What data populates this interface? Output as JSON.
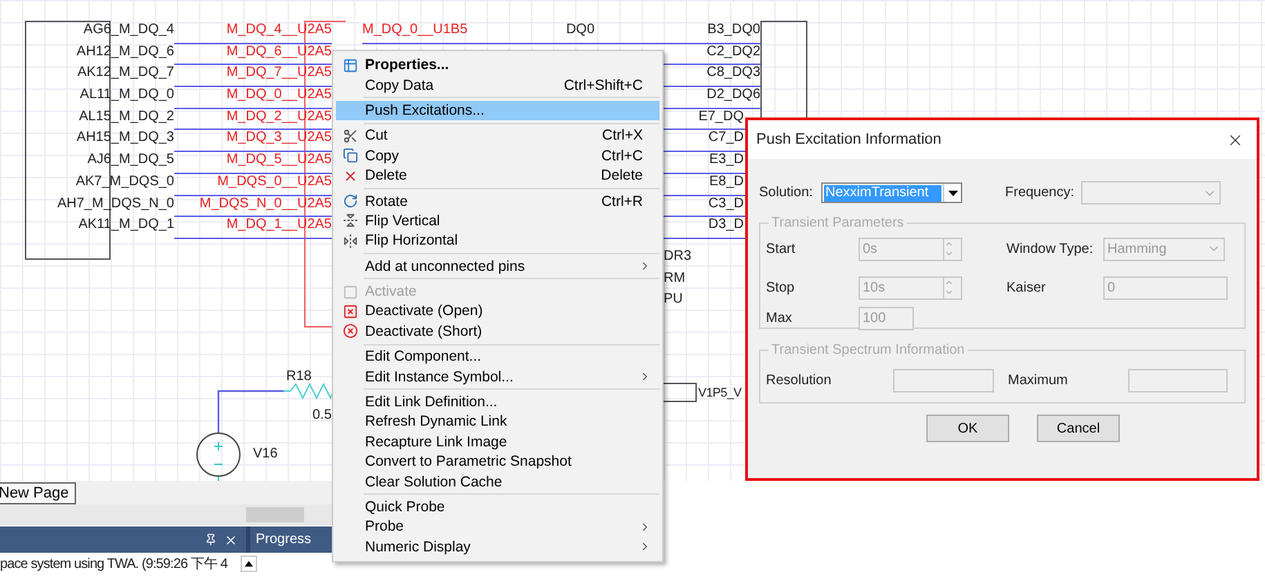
{
  "schematic": {
    "left_pins": [
      "AG6_M_DQ_4",
      "AH12_M_DQ_6",
      "AK12_M_DQ_7",
      "AL11_M_DQ_0",
      "AL15_M_DQ_2",
      "AH15_M_DQ_3",
      "AJ6_M_DQ_5",
      "AK7_M_DQS_0",
      "AH7_M_DQS_N_0",
      "AK11_M_DQ_1"
    ],
    "net_labels": [
      "M_DQ_4__U2A5",
      "M_DQ_6__U2A5",
      "M_DQ_7__U2A5",
      "M_DQ_0__U2A5",
      "M_DQ_2__U2A5",
      "M_DQ_3__U2A5",
      "M_DQ_5__U2A5",
      "M_DQS_0__U2A5",
      "M_DQS_N_0__U2A5",
      "M_DQ_1__U2A5"
    ],
    "far_net_label": "M_DQ_0__U1B5",
    "net_name": "DQ0",
    "right_pins": [
      "B3_DQ0",
      "C2_DQ2",
      "C8_DQ3",
      "D2_DQ6",
      "E7_DQ",
      "C7_D",
      "E3_D",
      "E8_D",
      "C3_D",
      "D3_D"
    ],
    "partial_labels": [
      "DR3",
      "RM",
      "PU"
    ],
    "resistor": {
      "name": "R18",
      "value": "0.5"
    },
    "source": {
      "name": "V16"
    },
    "port_label": "V1P5_V"
  },
  "page_tabs": [
    {
      "label": "New Page"
    }
  ],
  "output_panel": {
    "progress_title": "Progress",
    "message": "pace system using TWA. (9:59:26 下午 4"
  },
  "context_menu": [
    {
      "kind": "item",
      "label": "Properties...",
      "default": true,
      "submenu": false,
      "disabled": false,
      "selected": false
    },
    {
      "kind": "item",
      "label": "Copy Data",
      "default": false,
      "shortcut": "Ctrl+Shift+C",
      "submenu": false,
      "disabled": false,
      "selected": false
    },
    {
      "kind": "separator"
    },
    {
      "kind": "item",
      "label": "Push Excitations...",
      "default": false,
      "submenu": false,
      "disabled": false,
      "selected": true
    },
    {
      "kind": "separator"
    },
    {
      "kind": "item",
      "label": "Cut",
      "default": false,
      "shortcut": "Ctrl+X",
      "submenu": false,
      "disabled": false,
      "selected": false
    },
    {
      "kind": "item",
      "label": "Copy",
      "default": false,
      "shortcut": "Ctrl+C",
      "submenu": false,
      "disabled": false,
      "selected": false
    },
    {
      "kind": "item",
      "label": "Delete",
      "default": false,
      "shortcut": "Delete",
      "submenu": false,
      "disabled": false,
      "selected": false
    },
    {
      "kind": "separator"
    },
    {
      "kind": "item",
      "label": "Rotate",
      "default": false,
      "shortcut": "Ctrl+R",
      "submenu": false,
      "disabled": false,
      "selected": false
    },
    {
      "kind": "item",
      "label": "Flip Vertical",
      "default": false,
      "submenu": false,
      "disabled": false,
      "selected": false
    },
    {
      "kind": "item",
      "label": "Flip Horizontal",
      "default": false,
      "submenu": false,
      "disabled": false,
      "selected": false
    },
    {
      "kind": "separator"
    },
    {
      "kind": "item",
      "label": "Add at unconnected pins",
      "default": false,
      "submenu": true,
      "disabled": false,
      "selected": false
    },
    {
      "kind": "separator"
    },
    {
      "kind": "item",
      "label": "Activate",
      "default": false,
      "submenu": false,
      "disabled": true,
      "selected": false
    },
    {
      "kind": "item",
      "label": "Deactivate (Open)",
      "default": false,
      "submenu": false,
      "disabled": false,
      "selected": false
    },
    {
      "kind": "item",
      "label": "Deactivate (Short)",
      "default": false,
      "submenu": false,
      "disabled": false,
      "selected": false
    },
    {
      "kind": "separator"
    },
    {
      "kind": "item",
      "label": "Edit Component...",
      "default": false,
      "submenu": false,
      "disabled": false,
      "selected": false
    },
    {
      "kind": "item",
      "label": "Edit Instance Symbol...",
      "default": false,
      "submenu": true,
      "disabled": false,
      "selected": false
    },
    {
      "kind": "separator"
    },
    {
      "kind": "item",
      "label": "Edit Link Definition...",
      "default": false,
      "submenu": false,
      "disabled": false,
      "selected": false
    },
    {
      "kind": "item",
      "label": "Refresh Dynamic Link",
      "default": false,
      "submenu": false,
      "disabled": false,
      "selected": false
    },
    {
      "kind": "item",
      "label": "Recapture Link Image",
      "default": false,
      "submenu": false,
      "disabled": false,
      "selected": false
    },
    {
      "kind": "item",
      "label": "Convert to Parametric Snapshot",
      "default": false,
      "submenu": false,
      "disabled": false,
      "selected": false
    },
    {
      "kind": "item",
      "label": "Clear Solution Cache",
      "default": false,
      "submenu": false,
      "disabled": false,
      "selected": false
    },
    {
      "kind": "separator"
    },
    {
      "kind": "item",
      "label": "Quick Probe",
      "default": false,
      "submenu": false,
      "disabled": false,
      "selected": false
    },
    {
      "kind": "item",
      "label": "Probe",
      "default": false,
      "submenu": true,
      "disabled": false,
      "selected": false
    },
    {
      "kind": "item",
      "label": "Numeric Display",
      "default": false,
      "submenu": true,
      "disabled": false,
      "selected": false
    }
  ],
  "dialog": {
    "title": "Push Excitation Information",
    "solution": {
      "label": "Solution:",
      "value": "NexximTransient"
    },
    "frequency": {
      "label": "Frequency:",
      "disabled": true
    },
    "transient_parameters": {
      "title": "Transient Parameters",
      "disabled": true,
      "start": {
        "label": "Start",
        "value": "0s"
      },
      "window_type": {
        "label": "Window Type:",
        "value": "Hamming"
      },
      "stop": {
        "label": "Stop",
        "value": "10s"
      },
      "kaiser": {
        "label": "Kaiser",
        "value": "0"
      },
      "max": {
        "label": "Max",
        "value": "100"
      }
    },
    "transient_spectrum": {
      "title": "Transient Spectrum Information",
      "disabled": true,
      "resolution": {
        "label": "Resolution"
      },
      "maximum": {
        "label": "Maximum"
      }
    },
    "buttons": [
      "OK",
      "Cancel"
    ]
  }
}
